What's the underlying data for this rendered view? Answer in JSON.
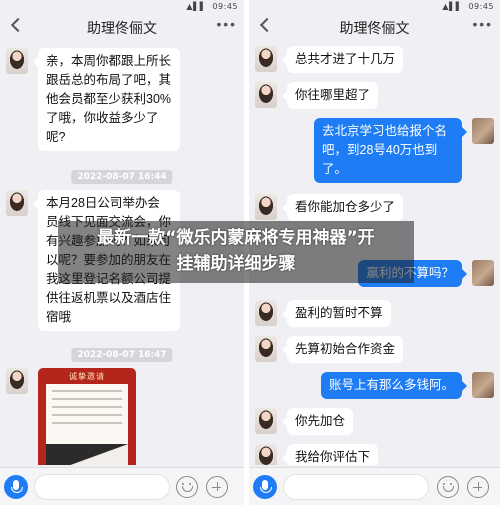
{
  "headline": {
    "line1": "最新一款“微乐内蒙麻将专用神器”开",
    "line2": "挂辅助详细步骤"
  },
  "left": {
    "status": {
      "signal": "▲▌▌",
      "time": "09:45"
    },
    "title": "助理佟俪文",
    "messages": [
      {
        "text": "亲，本周你都跟上所长跟岳总的布局了吧，其他会员都至少获利30%了哦，你收益多少了呢?"
      },
      {
        "timestamp": "2022-08-07 16:44"
      },
      {
        "text": "本月28日公司举办会员线下见面交流会，你有兴趣参加吗？如果可以呢？要参加的朋友在我这里登记名额公司提供往返机票以及酒店住宿哦"
      },
      {
        "timestamp": "2022-08-07 16:47"
      },
      {
        "card_caption": "诚挚邀请"
      }
    ],
    "icons": {
      "back": "back-arrow-icon",
      "more": "more-icon",
      "mic": "mic-icon",
      "emoji": "emoji-icon",
      "plus": "plus-icon"
    }
  },
  "right": {
    "status": {
      "signal": "▲▌▌",
      "time": "09:45"
    },
    "title": "助理佟俪文",
    "messages": [
      {
        "dir": "in",
        "text": "总共才进了十几万"
      },
      {
        "dir": "in",
        "text": "你往哪里超了"
      },
      {
        "dir": "out",
        "text": "去北京学习也给报个名吧，到28号40万也到了。"
      },
      {
        "dir": "in",
        "text": "看你能加仓多少了"
      },
      {
        "dir": "out",
        "text": "赢利的不算吗？"
      },
      {
        "dir": "in",
        "text": "盈利的暂时不算"
      },
      {
        "dir": "in",
        "text": "先算初始合作资金"
      },
      {
        "dir": "out",
        "text": "账号上有那么多钱阿。"
      },
      {
        "dir": "in",
        "text": "你先加仓"
      },
      {
        "dir": "in",
        "text": "我给你评估下"
      }
    ]
  },
  "colors": {
    "bubble_out": "#1e7cf5",
    "bubble_in": "#ffffff",
    "background": "#efeff4"
  }
}
